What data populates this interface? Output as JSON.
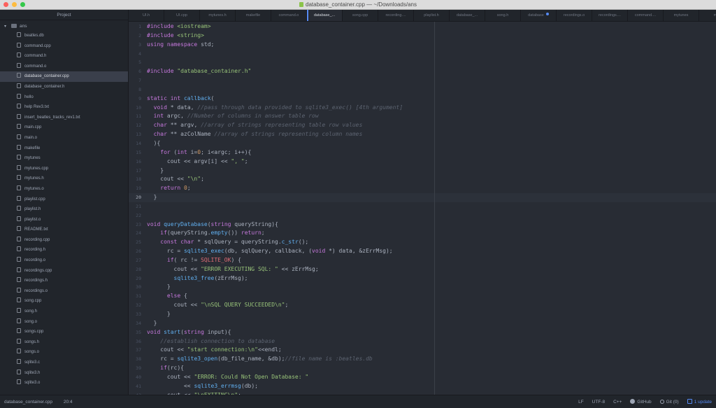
{
  "window": {
    "title": "database_container.cpp — ~/Downloads/ans"
  },
  "tree": {
    "header": "Project",
    "root": "ans",
    "items": [
      {
        "label": "beatles.db",
        "selected": false
      },
      {
        "label": "command.cpp",
        "selected": false
      },
      {
        "label": "command.h",
        "selected": false
      },
      {
        "label": "command.o",
        "selected": false
      },
      {
        "label": "database_container.cpp",
        "selected": true
      },
      {
        "label": "database_container.h",
        "selected": false
      },
      {
        "label": "hello",
        "selected": false
      },
      {
        "label": "help Rev3.txt",
        "selected": false
      },
      {
        "label": "insert_beatles_tracks_rev1.txt",
        "selected": false
      },
      {
        "label": "main.cpp",
        "selected": false
      },
      {
        "label": "main.o",
        "selected": false
      },
      {
        "label": "makefile",
        "selected": false
      },
      {
        "label": "mytunes",
        "selected": false
      },
      {
        "label": "mytunes.cpp",
        "selected": false
      },
      {
        "label": "mytunes.h",
        "selected": false
      },
      {
        "label": "mytunes.o",
        "selected": false
      },
      {
        "label": "playlist.cpp",
        "selected": false
      },
      {
        "label": "playlist.h",
        "selected": false
      },
      {
        "label": "playlist.o",
        "selected": false
      },
      {
        "label": "README.txt",
        "selected": false
      },
      {
        "label": "recording.cpp",
        "selected": false
      },
      {
        "label": "recording.h",
        "selected": false
      },
      {
        "label": "recording.o",
        "selected": false
      },
      {
        "label": "recordings.cpp",
        "selected": false
      },
      {
        "label": "recordings.h",
        "selected": false
      },
      {
        "label": "recordings.o",
        "selected": false
      },
      {
        "label": "song.cpp",
        "selected": false
      },
      {
        "label": "song.h",
        "selected": false
      },
      {
        "label": "song.o",
        "selected": false
      },
      {
        "label": "songs.cpp",
        "selected": false
      },
      {
        "label": "songs.h",
        "selected": false
      },
      {
        "label": "songs.o",
        "selected": false
      },
      {
        "label": "sqlite3.c",
        "selected": false
      },
      {
        "label": "sqlite3.h",
        "selected": false
      },
      {
        "label": "sqlite3.o",
        "selected": false
      }
    ]
  },
  "tabs": [
    {
      "label": "UI.h",
      "active": false,
      "modified": false
    },
    {
      "label": "UI.cpp",
      "active": false,
      "modified": false
    },
    {
      "label": "mytunes.h",
      "active": false,
      "modified": false
    },
    {
      "label": "makefile",
      "active": false,
      "modified": false
    },
    {
      "label": "command.o",
      "active": false,
      "modified": false
    },
    {
      "label": "database_...",
      "active": true,
      "modified": false
    },
    {
      "label": "song.cpp",
      "active": false,
      "modified": false
    },
    {
      "label": "recording....",
      "active": false,
      "modified": false
    },
    {
      "label": "playlist.h",
      "active": false,
      "modified": false
    },
    {
      "label": "database_...",
      "active": false,
      "modified": false
    },
    {
      "label": "song.h",
      "active": false,
      "modified": false
    },
    {
      "label": "database",
      "active": false,
      "modified": true
    },
    {
      "label": "recordings.o",
      "active": false,
      "modified": false
    },
    {
      "label": "recordings....",
      "active": false,
      "modified": false
    },
    {
      "label": "command....",
      "active": false,
      "modified": false
    },
    {
      "label": "mytunes",
      "active": false,
      "modified": false
    },
    {
      "label": "myt",
      "active": false,
      "modified": false
    }
  ],
  "editor": {
    "current_line": 20,
    "lines": [
      {
        "n": "1",
        "t": [
          [
            "tk-keyword",
            "#include "
          ],
          [
            "tk-string",
            "<iostream>"
          ]
        ]
      },
      {
        "n": "2",
        "t": [
          [
            "tk-keyword",
            "#include "
          ],
          [
            "tk-string",
            "<string>"
          ]
        ]
      },
      {
        "n": "3",
        "t": [
          [
            "tk-keyword",
            "using namespace "
          ],
          [
            "tk-plain",
            "std;"
          ]
        ]
      },
      {
        "n": "4",
        "t": []
      },
      {
        "n": "5",
        "t": []
      },
      {
        "n": "6",
        "t": [
          [
            "tk-keyword",
            "#include "
          ],
          [
            "tk-string",
            "\"database_container.h\""
          ]
        ]
      },
      {
        "n": "7",
        "t": []
      },
      {
        "n": "8",
        "t": []
      },
      {
        "n": "9",
        "t": [
          [
            "tk-keyword",
            "static int "
          ],
          [
            "tk-function",
            "callback"
          ],
          [
            "tk-plain",
            "("
          ]
        ]
      },
      {
        "n": "10",
        "t": [
          [
            "tk-plain",
            "  "
          ],
          [
            "tk-keyword",
            "void "
          ],
          [
            "tk-plain",
            "* data, "
          ],
          [
            "tk-comment",
            "//pass through data provided to sqlite3_exec() [4th argument]"
          ]
        ]
      },
      {
        "n": "11",
        "t": [
          [
            "tk-plain",
            "  "
          ],
          [
            "tk-keyword",
            "int "
          ],
          [
            "tk-plain",
            "argc, "
          ],
          [
            "tk-comment",
            "//Number of columns in answer table row"
          ]
        ]
      },
      {
        "n": "12",
        "t": [
          [
            "tk-plain",
            "  "
          ],
          [
            "tk-keyword",
            "char "
          ],
          [
            "tk-plain",
            "** argv, "
          ],
          [
            "tk-comment",
            "//array of strings representing table row values"
          ]
        ]
      },
      {
        "n": "13",
        "t": [
          [
            "tk-plain",
            "  "
          ],
          [
            "tk-keyword",
            "char "
          ],
          [
            "tk-plain",
            "** azColName "
          ],
          [
            "tk-comment",
            "//array of strings representing column names"
          ]
        ]
      },
      {
        "n": "14",
        "t": [
          [
            "tk-plain",
            "  ){"
          ]
        ]
      },
      {
        "n": "15",
        "t": [
          [
            "tk-plain",
            "    "
          ],
          [
            "tk-keyword",
            "for "
          ],
          [
            "tk-plain",
            "("
          ],
          [
            "tk-keyword",
            "int "
          ],
          [
            "tk-plain",
            "i="
          ],
          [
            "tk-number",
            "0"
          ],
          [
            "tk-plain",
            "; i<argc; i++){"
          ]
        ]
      },
      {
        "n": "16",
        "t": [
          [
            "tk-plain",
            "      cout << argv[i] << "
          ],
          [
            "tk-string",
            "\", \""
          ],
          [
            "tk-plain",
            ";"
          ]
        ]
      },
      {
        "n": "17",
        "t": [
          [
            "tk-plain",
            "    }"
          ]
        ]
      },
      {
        "n": "18",
        "t": [
          [
            "tk-plain",
            "    cout << "
          ],
          [
            "tk-string",
            "\"\\n\""
          ],
          [
            "tk-plain",
            ";"
          ]
        ]
      },
      {
        "n": "19",
        "t": [
          [
            "tk-plain",
            "    "
          ],
          [
            "tk-keyword",
            "return "
          ],
          [
            "tk-number",
            "0"
          ],
          [
            "tk-plain",
            ";"
          ]
        ]
      },
      {
        "n": "20",
        "t": [
          [
            "tk-plain",
            "  }"
          ]
        ]
      },
      {
        "n": "21",
        "t": []
      },
      {
        "n": "22",
        "t": []
      },
      {
        "n": "23",
        "t": [
          [
            "tk-keyword",
            "void "
          ],
          [
            "tk-function",
            "queryDatabase"
          ],
          [
            "tk-plain",
            "("
          ],
          [
            "tk-keyword",
            "string "
          ],
          [
            "tk-plain",
            "queryString){"
          ]
        ]
      },
      {
        "n": "24",
        "t": [
          [
            "tk-plain",
            "    "
          ],
          [
            "tk-keyword",
            "if"
          ],
          [
            "tk-plain",
            "(queryString."
          ],
          [
            "tk-function",
            "empty"
          ],
          [
            "tk-plain",
            "()) "
          ],
          [
            "tk-keyword",
            "return"
          ],
          [
            "tk-plain",
            ";"
          ]
        ]
      },
      {
        "n": "25",
        "t": [
          [
            "tk-plain",
            "    "
          ],
          [
            "tk-keyword",
            "const char "
          ],
          [
            "tk-plain",
            "* sqlQuery = queryString."
          ],
          [
            "tk-function",
            "c_str"
          ],
          [
            "tk-plain",
            "();"
          ]
        ]
      },
      {
        "n": "26",
        "t": [
          [
            "tk-plain",
            "      rc = "
          ],
          [
            "tk-function",
            "sqlite3_exec"
          ],
          [
            "tk-plain",
            "(db, sqlQuery, callback, ("
          ],
          [
            "tk-keyword",
            "void "
          ],
          [
            "tk-plain",
            "*) data, &zErrMsg);"
          ]
        ]
      },
      {
        "n": "27",
        "t": [
          [
            "tk-plain",
            "      "
          ],
          [
            "tk-keyword",
            "if"
          ],
          [
            "tk-plain",
            "( rc != "
          ],
          [
            "tk-constant",
            "SQLITE_OK"
          ],
          [
            "tk-plain",
            ") {"
          ]
        ]
      },
      {
        "n": "28",
        "t": [
          [
            "tk-plain",
            "        cout << "
          ],
          [
            "tk-string",
            "\"ERROR EXECUTING SQL: \""
          ],
          [
            "tk-plain",
            " << zErrMsg;"
          ]
        ]
      },
      {
        "n": "29",
        "t": [
          [
            "tk-plain",
            "        "
          ],
          [
            "tk-function",
            "sqlite3_free"
          ],
          [
            "tk-plain",
            "(zErrMsg);"
          ]
        ]
      },
      {
        "n": "30",
        "t": [
          [
            "tk-plain",
            "      }"
          ]
        ]
      },
      {
        "n": "31",
        "t": [
          [
            "tk-plain",
            "      "
          ],
          [
            "tk-keyword",
            "else "
          ],
          [
            "tk-plain",
            "{"
          ]
        ]
      },
      {
        "n": "32",
        "t": [
          [
            "tk-plain",
            "        cout << "
          ],
          [
            "tk-string",
            "\"\\nSQL QUERY SUCCEEDED\\n\""
          ],
          [
            "tk-plain",
            ";"
          ]
        ]
      },
      {
        "n": "33",
        "t": [
          [
            "tk-plain",
            "      }"
          ]
        ]
      },
      {
        "n": "34",
        "t": [
          [
            "tk-plain",
            "  }"
          ]
        ]
      },
      {
        "n": "35",
        "t": [
          [
            "tk-keyword",
            "void "
          ],
          [
            "tk-function",
            "start"
          ],
          [
            "tk-plain",
            "("
          ],
          [
            "tk-keyword",
            "string "
          ],
          [
            "tk-plain",
            "input){"
          ]
        ]
      },
      {
        "n": "36",
        "t": [
          [
            "tk-plain",
            "    "
          ],
          [
            "tk-comment",
            "//establish connection to database"
          ]
        ]
      },
      {
        "n": "37",
        "t": [
          [
            "tk-plain",
            "    cout << "
          ],
          [
            "tk-string",
            "\"start connection:\\n\""
          ],
          [
            "tk-plain",
            "<<endl;"
          ]
        ]
      },
      {
        "n": "38",
        "t": [
          [
            "tk-plain",
            "    rc = "
          ],
          [
            "tk-function",
            "sqlite3_open"
          ],
          [
            "tk-plain",
            "(db_file_name, &db);"
          ],
          [
            "tk-comment",
            "//file name is :beatles.db"
          ]
        ]
      },
      {
        "n": "39",
        "t": [
          [
            "tk-plain",
            "    "
          ],
          [
            "tk-keyword",
            "if"
          ],
          [
            "tk-plain",
            "(rc){"
          ]
        ]
      },
      {
        "n": "40",
        "t": [
          [
            "tk-plain",
            "      cout << "
          ],
          [
            "tk-string",
            "\"ERROR: Could Not Open Database: \""
          ]
        ]
      },
      {
        "n": "41",
        "t": [
          [
            "tk-plain",
            "           << "
          ],
          [
            "tk-function",
            "sqlite3_errmsg"
          ],
          [
            "tk-plain",
            "(db);"
          ]
        ]
      },
      {
        "n": "42",
        "t": [
          [
            "tk-plain",
            "      cout << "
          ],
          [
            "tk-string",
            "\"\\nEXITING\\n\""
          ],
          [
            "tk-plain",
            ";"
          ]
        ]
      }
    ]
  },
  "status": {
    "file": "database_container.cpp",
    "cursor": "20:4",
    "line_ending": "LF",
    "encoding": "UTF-8",
    "grammar": "C++",
    "github": "GitHub",
    "git": "Git (0)",
    "updates": "1 update"
  }
}
